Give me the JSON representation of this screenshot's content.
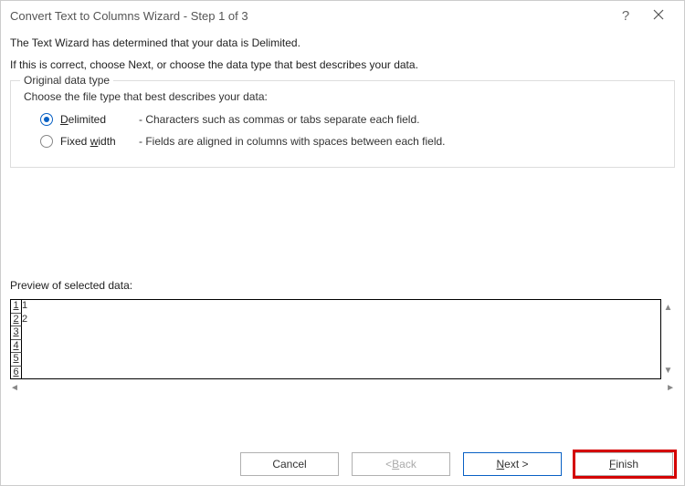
{
  "title": "Convert Text to Columns Wizard - Step 1 of 3",
  "intro1": "The Text Wizard has determined that your data is Delimited.",
  "intro2": "If this is correct, choose Next, or choose the data type that best describes your data.",
  "fieldset": {
    "legend": "Original data type",
    "prompt": "Choose the file type that best describes your data:",
    "delimited": {
      "label_pre": "",
      "label_u": "D",
      "label_post": "elimited",
      "desc": "- Characters such as commas or tabs separate each field."
    },
    "fixed": {
      "label_pre": "Fixed ",
      "label_u": "w",
      "label_post": "idth",
      "desc": "- Fields are aligned in columns with spaces between each field."
    }
  },
  "previewLabel": "Preview of selected data:",
  "previewRows": [
    {
      "a": "1",
      "b": "1"
    },
    {
      "a": "2",
      "b": "2"
    },
    {
      "a": "3",
      "b": ""
    },
    {
      "a": "4",
      "b": ""
    },
    {
      "a": "5",
      "b": ""
    },
    {
      "a": "6",
      "b": ""
    }
  ],
  "buttons": {
    "cancel": "Cancel",
    "back_pre": "< ",
    "back_u": "B",
    "back_post": "ack",
    "next_u": "N",
    "next_post": "ext >",
    "finish_u": "F",
    "finish_post": "inish"
  }
}
